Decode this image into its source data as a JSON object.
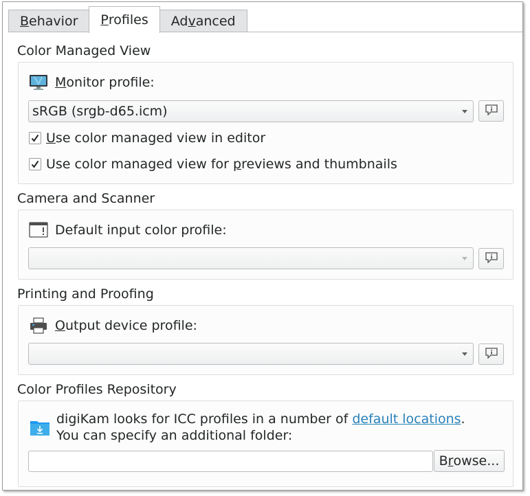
{
  "tabs": [
    {
      "label": "Behavior",
      "mnemonic_index": 0,
      "active": false
    },
    {
      "label": "Profiles",
      "mnemonic_index": 0,
      "active": true
    },
    {
      "label": "Advanced",
      "mnemonic_index": 2,
      "active": false
    }
  ],
  "color_managed_view": {
    "title": "Color Managed View",
    "monitor_label": "Monitor profile:",
    "monitor_mnemonic_index": 0,
    "monitor_value": "sRGB (srgb-d65.icm)",
    "checkbox_editor": {
      "label": "Use color managed view in editor",
      "mnemonic_index": 0,
      "checked": true
    },
    "checkbox_previews": {
      "label": "Use color managed view for previews and thumbnails",
      "mnemonic_index": 27,
      "checked": true
    }
  },
  "camera_scanner": {
    "title": "Camera and Scanner",
    "input_label": "Default input color profile:",
    "input_value": ""
  },
  "printing_proofing": {
    "title": "Printing and Proofing",
    "output_label": "Output device profile:",
    "output_mnemonic_index": 0,
    "output_value": ""
  },
  "repository": {
    "title": "Color Profiles Repository",
    "text_before_link": "digiKam looks for ICC profiles in a number of ",
    "link_text": "default locations",
    "text_after_link": ".",
    "line2": "You can specify an additional folder:",
    "folder_value": "",
    "browse_label": "Browse...",
    "browse_mnemonic_index": 1
  },
  "icons": {
    "monitor": "monitor-icon",
    "input": "input-device-icon",
    "printer": "printer-icon",
    "folder": "folder-download-icon",
    "info": "info-icon"
  },
  "colors": {
    "link": "#2980b9",
    "text": "#232627",
    "folder": "#3daee9"
  }
}
